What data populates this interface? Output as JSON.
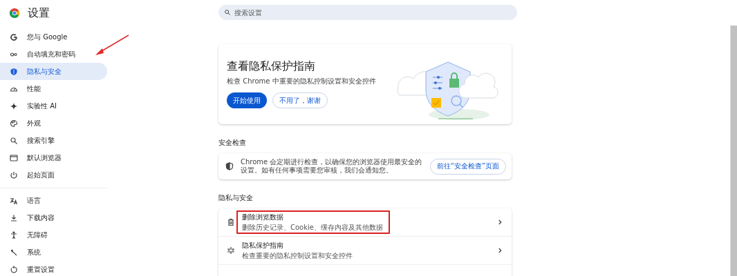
{
  "header": {
    "title": "设置"
  },
  "search": {
    "placeholder": "搜索设置"
  },
  "sidebar": {
    "groups": [
      {
        "items": [
          {
            "label": "您与 Google",
            "selected": false
          },
          {
            "label": "自动填充和密码",
            "selected": false
          },
          {
            "label": "隐私与安全",
            "selected": true
          },
          {
            "label": "性能",
            "selected": false
          },
          {
            "label": "实验性 AI",
            "selected": false
          },
          {
            "label": "外观",
            "selected": false
          },
          {
            "label": "搜索引擎",
            "selected": false
          },
          {
            "label": "默认浏览器",
            "selected": false
          },
          {
            "label": "起始页面",
            "selected": false
          }
        ]
      },
      {
        "items": [
          {
            "label": "语言",
            "selected": false
          },
          {
            "label": "下载内容",
            "selected": false
          },
          {
            "label": "无障碍",
            "selected": false
          },
          {
            "label": "系统",
            "selected": false
          },
          {
            "label": "重置设置",
            "selected": false
          }
        ]
      }
    ]
  },
  "promo": {
    "title": "查看隐私保护指南",
    "description": "检查 Chrome 中重要的隐私控制设置和安全控件",
    "buttons": [
      {
        "label": "开始使用",
        "kind": "primary"
      },
      {
        "label": "不用了，谢谢",
        "kind": "outline"
      }
    ]
  },
  "safety_check": {
    "heading": "安全检查",
    "text": "Chrome 会定期进行检查，以确保您的浏览器使用最安全的设置。如有任何事项需要您审核，我们会通知您。",
    "button": "前往“安全检查”页面"
  },
  "privacy": {
    "heading": "隐私与安全",
    "rows": [
      {
        "title": "删除浏览数据",
        "description": "删除历史记录、Cookie、缓存内容及其他数据",
        "highlighted": true
      },
      {
        "title": "隐私保护指南",
        "description": "检查重要的隐私控制设置和安全控件",
        "highlighted": false
      }
    ]
  }
}
